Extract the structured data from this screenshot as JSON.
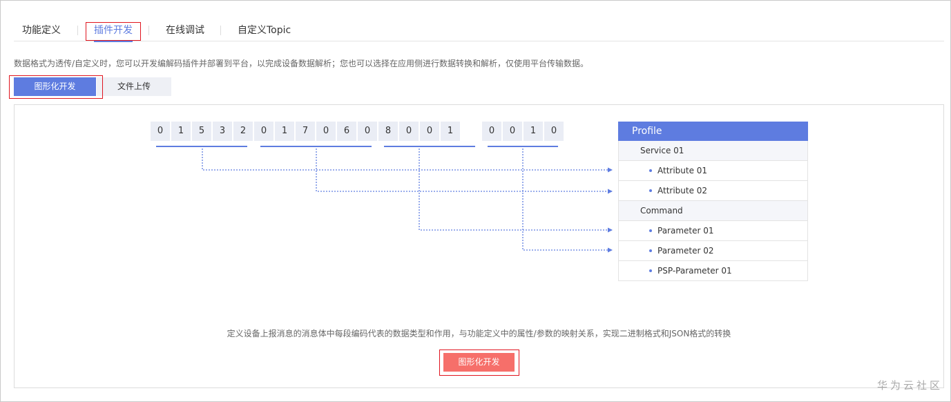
{
  "tabs": [
    "功能定义",
    "插件开发",
    "在线调试",
    "自定义Topic"
  ],
  "active_tab": "插件开发",
  "description": "数据格式为透传/自定义时，您可以开发编解码插件并部署到平台，以完成设备数据解析；您也可以选择在应用侧进行数据转换和解析，仅使用平台传输数据。",
  "mode_buttons": {
    "graphical": "图形化开发",
    "upload": "文件上传"
  },
  "bytes": [
    "0",
    "1",
    "5",
    "3",
    "2",
    "0",
    "1",
    "7",
    "0",
    "6",
    "0",
    "8",
    "0",
    "0",
    "1",
    "0",
    "0",
    "1",
    "0"
  ],
  "profile": {
    "title": "Profile",
    "service": "Service 01",
    "attributes": [
      "Attribute 01",
      "Attribute 02"
    ],
    "command": "Command",
    "parameters": [
      "Parameter 01",
      "Parameter 02",
      "PSP-Parameter 01"
    ]
  },
  "bottom_description": "定义设备上报消息的消息体中每段编码代表的数据类型和作用，与功能定义中的属性/参数的映射关系，实现二进制格式和JSON格式的转换",
  "cta_label": "图形化开发",
  "watermark": "华为云社区",
  "colors": {
    "accent": "#5e7ce0",
    "cta": "#f66f6a",
    "highlight": "#e0141e"
  }
}
